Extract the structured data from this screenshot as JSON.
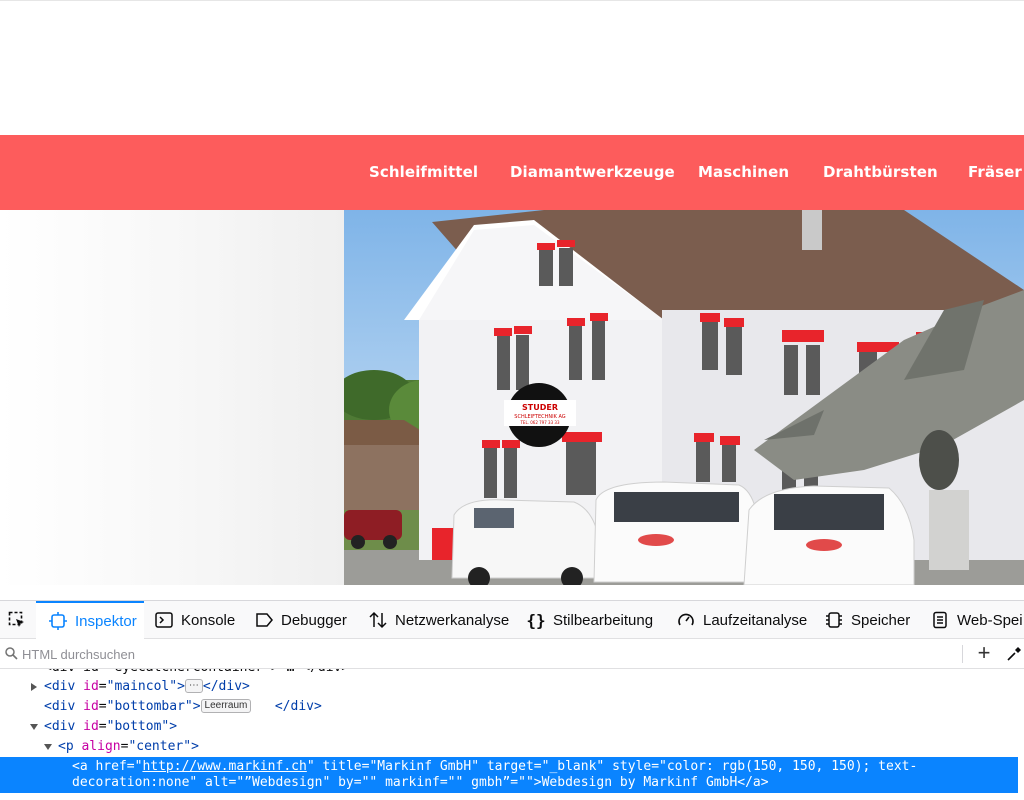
{
  "nav": {
    "items": [
      "Schleifmittel",
      "Diamantwerkzeuge",
      "Maschinen",
      "Drahtbürsten",
      "Fräser u"
    ],
    "color": "#fd5c5c"
  },
  "hero": {
    "sign_line1": "STUDER",
    "sign_line2": "SCHLEIFTECHNIK AG",
    "sign_line3": "TEL. 062 797 33 33"
  },
  "devtools": {
    "tabs": [
      {
        "label": "Inspektor",
        "icon": "inspector-icon",
        "selected": true
      },
      {
        "label": "Konsole",
        "icon": "console-icon"
      },
      {
        "label": "Debugger",
        "icon": "debugger-icon"
      },
      {
        "label": "Netzwerkanalyse",
        "icon": "network-icon"
      },
      {
        "label": "Stilbearbeitung",
        "icon": "style-editor-icon"
      },
      {
        "label": "Laufzeitanalyse",
        "icon": "performance-icon"
      },
      {
        "label": "Speicher",
        "icon": "memory-icon"
      },
      {
        "label": "Web-Spei",
        "icon": "storage-icon"
      }
    ],
    "search_placeholder": "HTML durchsuchen",
    "tree": {
      "row0": "<div id=\"eyecatchercontainer\"> … </div>",
      "row1": {
        "tag_open": "<div",
        "attr": "id",
        "val": "\"maincol\"",
        "close": ">",
        "end": "</div>"
      },
      "row2": {
        "tag_open": "<div",
        "attr": "id",
        "val": "\"bottombar\"",
        "close": ">",
        "badge": "Leerraum",
        "end": "</div>"
      },
      "row3": {
        "tag_open": "<div",
        "attr": "id",
        "val": "\"bottom\"",
        "close": ">"
      },
      "row4": {
        "tag_open": "<p",
        "attr": "align",
        "val": "\"center\"",
        "close": ">"
      },
      "selected": {
        "prefix": "<a href=\"",
        "href": "http://www.markinf.ch",
        "rest": "\" title=\"Markinf GmbH\" target=\"_blank\" style=\"color: rgb(150, 150, 150); text-decoration:none\" alt=\"”Webdesign\" by=\"\" markinf=\"\" gmbh”=\"\">Webdesign by Markinf GmbH</a>"
      }
    }
  }
}
